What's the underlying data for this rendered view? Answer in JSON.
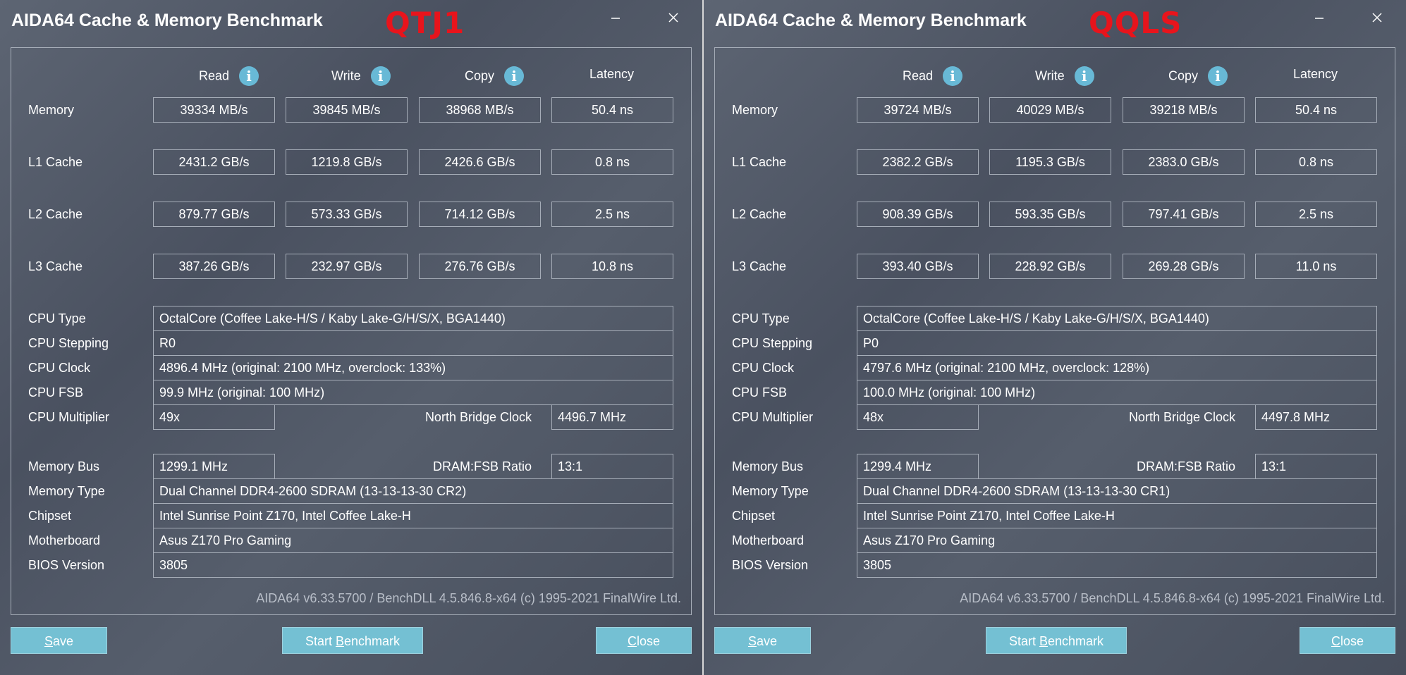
{
  "windows": [
    {
      "title": "AIDA64 Cache & Memory Benchmark",
      "tag": "QTJ1",
      "headers": {
        "read": "Read",
        "write": "Write",
        "copy": "Copy",
        "latency": "Latency"
      },
      "rows": [
        {
          "label": "Memory",
          "read": "39334 MB/s",
          "write": "39845 MB/s",
          "copy": "38968 MB/s",
          "latency": "50.4 ns"
        },
        {
          "label": "L1 Cache",
          "read": "2431.2 GB/s",
          "write": "1219.8 GB/s",
          "copy": "2426.6 GB/s",
          "latency": "0.8 ns"
        },
        {
          "label": "L2 Cache",
          "read": "879.77 GB/s",
          "write": "573.33 GB/s",
          "copy": "714.12 GB/s",
          "latency": "2.5 ns"
        },
        {
          "label": "L3 Cache",
          "read": "387.26 GB/s",
          "write": "232.97 GB/s",
          "copy": "276.76 GB/s",
          "latency": "10.8 ns"
        }
      ],
      "cpu_type": {
        "label": "CPU Type",
        "value": "OctalCore   (Coffee Lake-H/S / Kaby Lake-G/H/S/X, BGA1440)"
      },
      "cpu_stepping": {
        "label": "CPU Stepping",
        "value": "R0"
      },
      "cpu_clock": {
        "label": "CPU Clock",
        "value": "4896.4 MHz  (original: 2100 MHz, overclock: 133%)"
      },
      "cpu_fsb": {
        "label": "CPU FSB",
        "value": "99.9 MHz  (original: 100 MHz)"
      },
      "cpu_multiplier": {
        "label": "CPU Multiplier",
        "value": "49x"
      },
      "nb_clock": {
        "label": "North Bridge Clock",
        "value": "4496.7 MHz"
      },
      "memory_bus": {
        "label": "Memory Bus",
        "value": "1299.1 MHz"
      },
      "dram_ratio": {
        "label": "DRAM:FSB Ratio",
        "value": "13:1"
      },
      "memory_type": {
        "label": "Memory Type",
        "value": "Dual Channel DDR4-2600 SDRAM  (13-13-13-30 CR2)"
      },
      "chipset": {
        "label": "Chipset",
        "value": "Intel Sunrise Point Z170, Intel Coffee Lake-H"
      },
      "motherboard": {
        "label": "Motherboard",
        "value": "Asus Z170 Pro Gaming"
      },
      "bios": {
        "label": "BIOS Version",
        "value": "3805"
      },
      "footer": "AIDA64 v6.33.5700 / BenchDLL 4.5.846.8-x64  (c) 1995-2021 FinalWire Ltd.",
      "buttons": {
        "save": {
          "pre": "",
          "u": "S",
          "post": "ave"
        },
        "start": {
          "pre": "Start ",
          "u": "B",
          "post": "enchmark"
        },
        "close": {
          "pre": "",
          "u": "C",
          "post": "lose"
        }
      }
    },
    {
      "title": "AIDA64 Cache & Memory Benchmark",
      "tag": "QQLS",
      "headers": {
        "read": "Read",
        "write": "Write",
        "copy": "Copy",
        "latency": "Latency"
      },
      "rows": [
        {
          "label": "Memory",
          "read": "39724 MB/s",
          "write": "40029 MB/s",
          "copy": "39218 MB/s",
          "latency": "50.4 ns"
        },
        {
          "label": "L1 Cache",
          "read": "2382.2 GB/s",
          "write": "1195.3 GB/s",
          "copy": "2383.0 GB/s",
          "latency": "0.8 ns"
        },
        {
          "label": "L2 Cache",
          "read": "908.39 GB/s",
          "write": "593.35 GB/s",
          "copy": "797.41 GB/s",
          "latency": "2.5 ns"
        },
        {
          "label": "L3 Cache",
          "read": "393.40 GB/s",
          "write": "228.92 GB/s",
          "copy": "269.28 GB/s",
          "latency": "11.0 ns"
        }
      ],
      "cpu_type": {
        "label": "CPU Type",
        "value": "OctalCore   (Coffee Lake-H/S / Kaby Lake-G/H/S/X, BGA1440)"
      },
      "cpu_stepping": {
        "label": "CPU Stepping",
        "value": "P0"
      },
      "cpu_clock": {
        "label": "CPU Clock",
        "value": "4797.6 MHz  (original: 2100 MHz, overclock: 128%)"
      },
      "cpu_fsb": {
        "label": "CPU FSB",
        "value": "100.0 MHz  (original: 100 MHz)"
      },
      "cpu_multiplier": {
        "label": "CPU Multiplier",
        "value": "48x"
      },
      "nb_clock": {
        "label": "North Bridge Clock",
        "value": "4497.8 MHz"
      },
      "memory_bus": {
        "label": "Memory Bus",
        "value": "1299.4 MHz"
      },
      "dram_ratio": {
        "label": "DRAM:FSB Ratio",
        "value": "13:1"
      },
      "memory_type": {
        "label": "Memory Type",
        "value": "Dual Channel DDR4-2600 SDRAM  (13-13-13-30 CR1)"
      },
      "chipset": {
        "label": "Chipset",
        "value": "Intel Sunrise Point Z170, Intel Coffee Lake-H"
      },
      "motherboard": {
        "label": "Motherboard",
        "value": "Asus Z170 Pro Gaming"
      },
      "bios": {
        "label": "BIOS Version",
        "value": "3805"
      },
      "footer": "AIDA64 v6.33.5700 / BenchDLL 4.5.846.8-x64  (c) 1995-2021 FinalWire Ltd.",
      "buttons": {
        "save": {
          "pre": "",
          "u": "S",
          "post": "ave"
        },
        "start": {
          "pre": "Start ",
          "u": "B",
          "post": "enchmark"
        },
        "close": {
          "pre": "",
          "u": "C",
          "post": "lose"
        }
      }
    }
  ],
  "colors": {
    "accent": "#74c0d3",
    "tag_red": "#e8141c",
    "panel_bg": "#525a68",
    "info_icon": "#68b9d6"
  },
  "icons": {
    "info": "info-icon",
    "minimize": "minimize-icon",
    "close": "close-icon"
  }
}
